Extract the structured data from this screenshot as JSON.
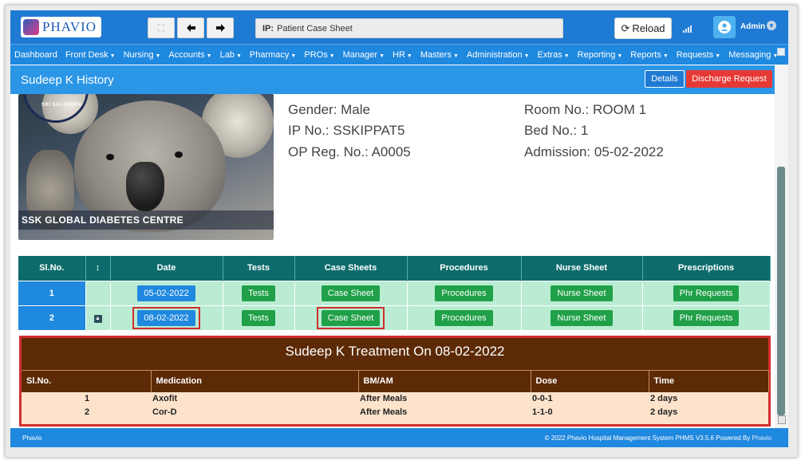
{
  "app": {
    "logo_text": "PHAVIO",
    "ip_label": "IP:",
    "ip_value": "Patient Case Sheet",
    "reload_label": "Reload",
    "user_name": "Admin"
  },
  "menu": [
    "Dashboard",
    "Front Desk",
    "Nursing",
    "Accounts",
    "Lab",
    "Pharmacy",
    "PROs",
    "Manager",
    "HR",
    "Masters",
    "Administration",
    "Extras",
    "Reporting",
    "Reports",
    "Requests",
    "Messaging"
  ],
  "menu_has_caret": [
    false,
    true,
    true,
    true,
    true,
    true,
    true,
    true,
    true,
    true,
    true,
    true,
    true,
    true,
    true,
    true
  ],
  "page": {
    "title": "Sudeep K History",
    "details_label": "Details",
    "discharge_label": "Discharge Request"
  },
  "patient": {
    "photo_caption": "SSK GLOBAL DIABETES CENTRE",
    "seal_text": "SRI SAI KRUPA",
    "gender": "Gender: Male",
    "ip_no": "IP No.: SSKIPPAT5",
    "op_reg": "OP Reg. No.: A0005",
    "room": "Room No.: ROOM 1",
    "bed": "Bed No.: 1",
    "admission": "Admission: 05-02-2022"
  },
  "visits": {
    "headers": [
      "Sl.No.",
      "↕",
      "Date",
      "Tests",
      "Case Sheets",
      "Procedures",
      "Nurse Sheet",
      "Prescriptions"
    ],
    "rows": [
      {
        "sl": "1",
        "date": "05-02-2022",
        "tests": "Tests",
        "case_sheet": "Case Sheet",
        "procedures": "Procedures",
        "nurse_sheet": "Nurse Sheet",
        "prescriptions": "Phr Requests"
      },
      {
        "sl": "2",
        "date": "08-02-2022",
        "tests": "Tests",
        "case_sheet": "Case Sheet",
        "procedures": "Procedures",
        "nurse_sheet": "Nurse Sheet",
        "prescriptions": "Phr Requests"
      }
    ]
  },
  "treatment": {
    "title": "Sudeep K Treatment On 08-02-2022",
    "headers": [
      "Sl.No.",
      "Medication",
      "BM/AM",
      "Dose",
      "Time"
    ],
    "rows": [
      {
        "sl": "1",
        "medication": "Axofit",
        "bm_am": "After Meals",
        "dose": "0-0-1",
        "time": "2 days"
      },
      {
        "sl": "2",
        "medication": "Cor-D",
        "bm_am": "After Meals",
        "dose": "1-1-0",
        "time": "2 days"
      }
    ]
  },
  "footer": {
    "left": "Phavio",
    "right_prefix": "© 2022 Phavio Hospital Management System PHMS V3.5.6 Powered By",
    "right_link": "Phavio"
  },
  "colors": {
    "topbar": "#1f7ad3",
    "menubar": "#1f88df",
    "table_header": "#0e6b6b",
    "table_row": "#b9ecd3",
    "treatment_header": "#5c2a06",
    "treatment_body": "#fde3cc",
    "highlight": "#d32f2f",
    "discharge": "#e53935",
    "action_green": "#20a048"
  },
  "icons": [
    "expand-icon",
    "arrow-left-icon",
    "arrow-right-icon",
    "reload-icon",
    "signal-icon",
    "user-avatar-icon",
    "chevron-down-icon",
    "sort-icon",
    "collapse-icon"
  ]
}
